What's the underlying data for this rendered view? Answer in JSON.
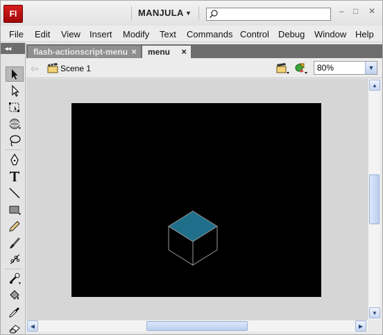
{
  "app": {
    "logo_text": "Fl",
    "workspace": "MANJULA",
    "search": {
      "value": "",
      "placeholder": ""
    }
  },
  "menu": [
    "File",
    "Edit",
    "View",
    "Insert",
    "Modify",
    "Text",
    "Commands",
    "Control",
    "Debug",
    "Window",
    "Help"
  ],
  "tools_header": "◂◂",
  "tools": [
    "selection",
    "subselection",
    "free-transform",
    "3d-rotation",
    "lasso",
    "pen",
    "text",
    "line",
    "rectangle",
    "pencil",
    "brush",
    "deco",
    "bone",
    "paint-bucket",
    "eyedropper",
    "eraser"
  ],
  "tabs": [
    {
      "label": "flash-actionscript-menu",
      "active": false,
      "close": "×"
    },
    {
      "label": "menu",
      "active": true,
      "close": "×"
    }
  ],
  "editbar": {
    "scene": "Scene 1",
    "zoom": "80%"
  },
  "stage": {
    "background": "#000000",
    "cube_top_color": "#1f6f8b",
    "cube_edge_color": "#9a9a9a"
  },
  "colors": {
    "accent": "#b7c9ee",
    "logo_red": "#c0141a"
  }
}
